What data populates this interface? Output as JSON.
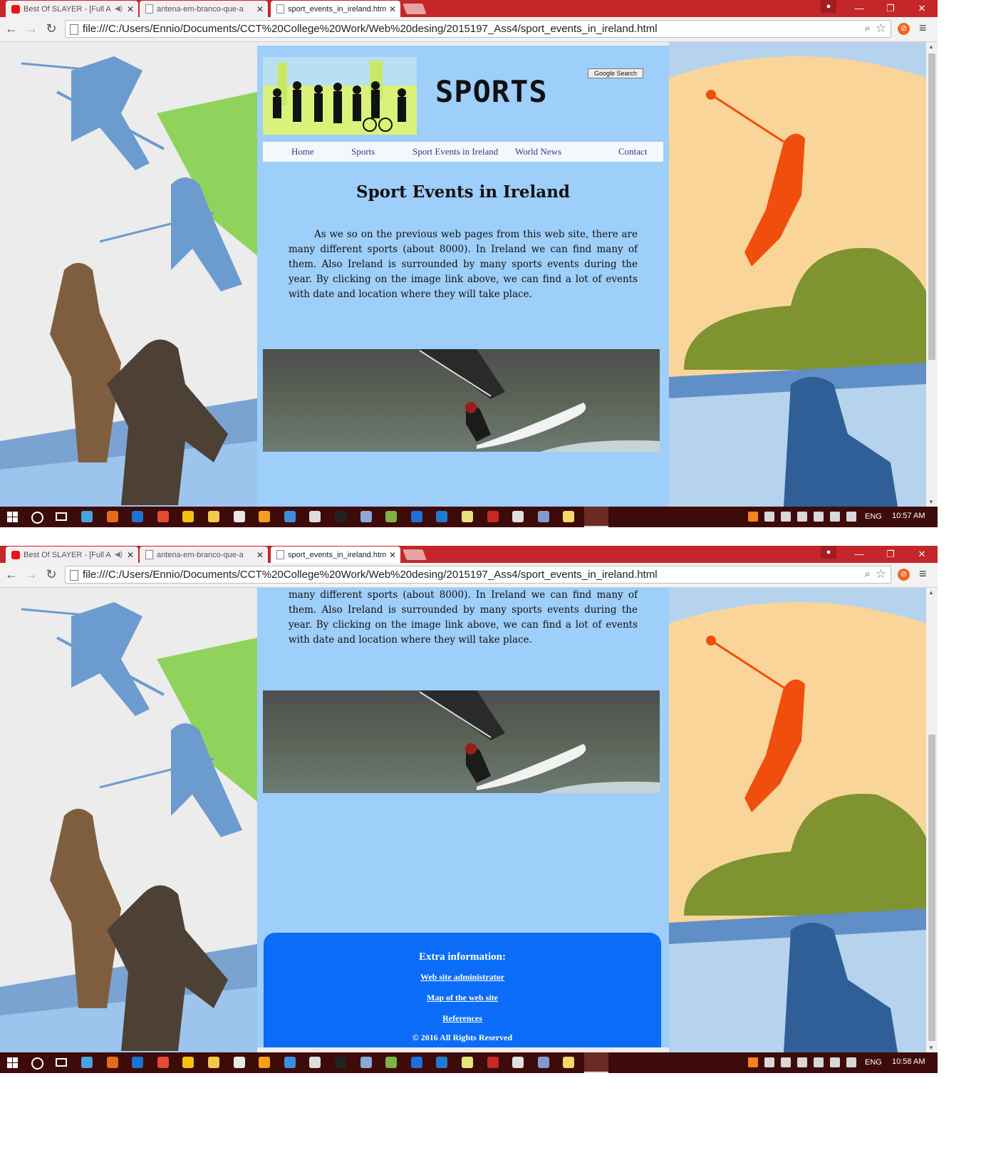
{
  "browser": {
    "tabs": [
      {
        "title": "Best Of SLAYER - [Full A",
        "favicon": "youtube-icon",
        "audio": true
      },
      {
        "title": "antena-em-branco-que-a",
        "favicon": "page-icon"
      },
      {
        "title": "sport_events_in_ireland.htm",
        "favicon": "page-icon",
        "active": true
      }
    ],
    "url": "file:///C:/Users/Ennio/Documents/CCT%20College%20Work/Web%20desing/2015197_Ass4/sport_events_in_ireland.html"
  },
  "site": {
    "brand": "SPORTS",
    "search_button": "Google Search",
    "nav": [
      "Home",
      "Sports",
      "Sport Events in Ireland",
      "World News",
      "Contact"
    ],
    "page_title": "Sport Events in Ireland",
    "intro": "As we so on the previous web pages from this web site, there are many different sports (about 8000). In Ireland we can find many of them. Also Ireland is surrounded by many sports events during the year. By clicking on the image link above, we can find a lot of events with date and location where they will take place.",
    "footer": {
      "heading": "Extra information:",
      "links": [
        "Web site administrator",
        "Map of the web site",
        "References"
      ],
      "copyright": "© 2016 All Rights Reserved"
    }
  },
  "taskbar": {
    "language": "ENG",
    "clock_first": "10:57 AM",
    "clock_second": "10:58 AM"
  },
  "colors": {
    "content_bg": "#9ecefa",
    "footer_bg": "#0a6cf7",
    "chrome_red": "#c4262a",
    "taskbar_bg": "#3d0b09"
  }
}
